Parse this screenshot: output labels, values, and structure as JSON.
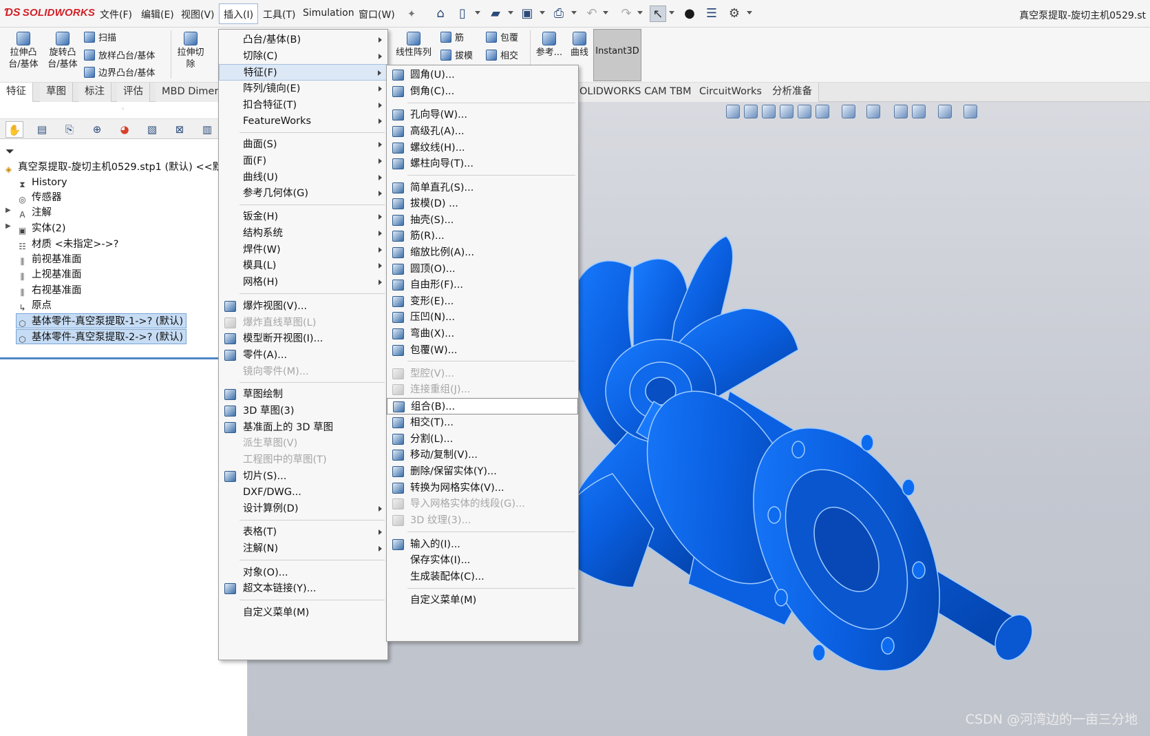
{
  "app": {
    "logo": "SOLIDWORKS",
    "window_title": "真空泵提取-旋切主机0529.st"
  },
  "menubar": {
    "items": [
      "文件(F)",
      "编辑(E)",
      "视图(V)",
      "插入(I)",
      "工具(T)",
      "Simulation",
      "窗口(W)"
    ],
    "active": "插入(I)"
  },
  "toolbar_icons": [
    "home-icon",
    "new-file-icon",
    "open-file-icon",
    "save-icon",
    "print-icon",
    "undo-icon",
    "redo-icon",
    "select-pointer-icon",
    "traffic-light-icon",
    "options-list-icon",
    "gear-icon"
  ],
  "command_manager": {
    "extrude_boss": "拉伸凸\n台/基体",
    "revolve_boss": "旋转凸\n台/基体",
    "sweep": "扫描",
    "loft_boss": "放样凸台/基体",
    "boundary_boss": "边界凸台/基体",
    "extrude_cut": "拉伸切\n除",
    "linear_pattern": "线性阵列",
    "rib": "筋",
    "wrap": "包覆",
    "draft": "拔模",
    "intersect": "相交",
    "reference": "参考...",
    "curves": "曲线",
    "instant3d": "Instant3D"
  },
  "tabs": {
    "left": [
      "特征",
      "草图",
      "标注",
      "评估",
      "MBD Dimen"
    ],
    "right": [
      "OLIDWORKS CAM TBM",
      "CircuitWorks",
      "分析准备"
    ]
  },
  "feature_tree": {
    "root": "真空泵提取-旋切主机0529.stp1 (默认) <<默",
    "items": [
      {
        "label": "History",
        "icon": "history-folder-icon"
      },
      {
        "label": "传感器",
        "icon": "sensor-folder-icon"
      },
      {
        "label": "注解",
        "icon": "annotation-icon"
      },
      {
        "label": "实体(2)",
        "icon": "solid-bodies-folder-icon"
      },
      {
        "label": "材质 <未指定>->?",
        "icon": "material-icon"
      },
      {
        "label": "前视基准面",
        "icon": "plane-icon"
      },
      {
        "label": "上视基准面",
        "icon": "plane-icon"
      },
      {
        "label": "右视基准面",
        "icon": "plane-icon"
      },
      {
        "label": "原点",
        "icon": "origin-icon"
      },
      {
        "label": "基体零件-真空泵提取-1->? (默认)",
        "icon": "base-part-icon"
      },
      {
        "label": "基体零件-真空泵提取-2->? (默认)",
        "icon": "base-part-icon"
      }
    ]
  },
  "insert_menu": {
    "items": [
      {
        "label": "凸台/基体(B)",
        "submenu": true
      },
      {
        "label": "切除(C)",
        "submenu": true
      },
      {
        "label": "特征(F)",
        "submenu": true,
        "selected": true
      },
      {
        "label": "阵列/镜向(E)",
        "submenu": true
      },
      {
        "label": "扣合特征(T)",
        "submenu": true
      },
      {
        "label": "FeatureWorks",
        "submenu": true
      },
      {
        "label": "曲面(S)",
        "submenu": true
      },
      {
        "label": "面(F)",
        "submenu": true
      },
      {
        "label": "曲线(U)",
        "submenu": true
      },
      {
        "label": "参考几何体(G)",
        "submenu": true
      },
      {
        "label": "钣金(H)",
        "submenu": true
      },
      {
        "label": "结构系统",
        "submenu": true
      },
      {
        "label": "焊件(W)",
        "submenu": true
      },
      {
        "label": "模具(L)",
        "submenu": true
      },
      {
        "label": "网格(H)",
        "submenu": true
      },
      {
        "label": "爆炸视图(V)...",
        "icon": true
      },
      {
        "label": "爆炸直线草图(L)",
        "icon": true,
        "disabled": true
      },
      {
        "label": "模型断开视图(I)...",
        "icon": true
      },
      {
        "label": "零件(A)...",
        "icon": true
      },
      {
        "label": "镜向零件(M)...",
        "disabled": true
      },
      {
        "label": "草图绘制",
        "icon": true
      },
      {
        "label": "3D 草图(3)",
        "icon": true
      },
      {
        "label": "基准面上的 3D 草图",
        "icon": true
      },
      {
        "label": "派生草图(V)",
        "disabled": true
      },
      {
        "label": "工程图中的草图(T)",
        "disabled": true
      },
      {
        "label": "切片(S)...",
        "icon": true
      },
      {
        "label": "DXF/DWG..."
      },
      {
        "label": "设计算例(D)",
        "submenu": true
      },
      {
        "label": "表格(T)",
        "submenu": true
      },
      {
        "label": "注解(N)",
        "submenu": true
      },
      {
        "label": "对象(O)..."
      },
      {
        "label": "超文本链接(Y)...",
        "icon": true
      },
      {
        "label": "自定义菜单(M)"
      }
    ]
  },
  "feature_menu": {
    "items": [
      {
        "label": "圆角(U)...",
        "icon": true
      },
      {
        "label": "倒角(C)...",
        "icon": true
      },
      {
        "label": "孔向导(W)...",
        "icon": true
      },
      {
        "label": "高级孔(A)...",
        "icon": true
      },
      {
        "label": "螺纹线(H)...",
        "icon": true
      },
      {
        "label": "螺柱向导(T)...",
        "icon": true
      },
      {
        "label": "简单直孔(S)...",
        "icon": true
      },
      {
        "label": "拔模(D) ...",
        "icon": true
      },
      {
        "label": "抽壳(S)...",
        "icon": true
      },
      {
        "label": "筋(R)...",
        "icon": true
      },
      {
        "label": "缩放比例(A)...",
        "icon": true
      },
      {
        "label": "圆顶(O)...",
        "icon": true
      },
      {
        "label": "自由形(F)...",
        "icon": true
      },
      {
        "label": "变形(E)...",
        "icon": true
      },
      {
        "label": "压凹(N)...",
        "icon": true
      },
      {
        "label": "弯曲(X)...",
        "icon": true
      },
      {
        "label": "包覆(W)...",
        "icon": true
      },
      {
        "label": "型腔(V)...",
        "icon": true,
        "disabled": true
      },
      {
        "label": "连接重组(J)...",
        "icon": true,
        "disabled": true
      },
      {
        "label": "组合(B)...",
        "icon": true,
        "highlighted": true
      },
      {
        "label": "相交(T)...",
        "icon": true
      },
      {
        "label": "分割(L)...",
        "icon": true
      },
      {
        "label": "移动/复制(V)...",
        "icon": true
      },
      {
        "label": "删除/保留实体(Y)...",
        "icon": true
      },
      {
        "label": "转换为网格实体(V)...",
        "icon": true
      },
      {
        "label": "导入网格实体的线段(G)...",
        "icon": true,
        "disabled": true
      },
      {
        "label": "3D 纹理(3)...",
        "icon": true,
        "disabled": true
      },
      {
        "label": "输入的(I)...",
        "icon": true
      },
      {
        "label": "保存实体(I)..."
      },
      {
        "label": "生成装配体(C)..."
      },
      {
        "label": "自定义菜单(M)"
      }
    ]
  },
  "watermark": "CSDN @河湾边的一亩三分地",
  "colors": {
    "model_blue": "#0a5fe0",
    "model_edge": "#9ecbff",
    "viewport_bg": "#c6cad2",
    "arrow_red": "#e0231a",
    "logo_red": "#d21f26"
  }
}
